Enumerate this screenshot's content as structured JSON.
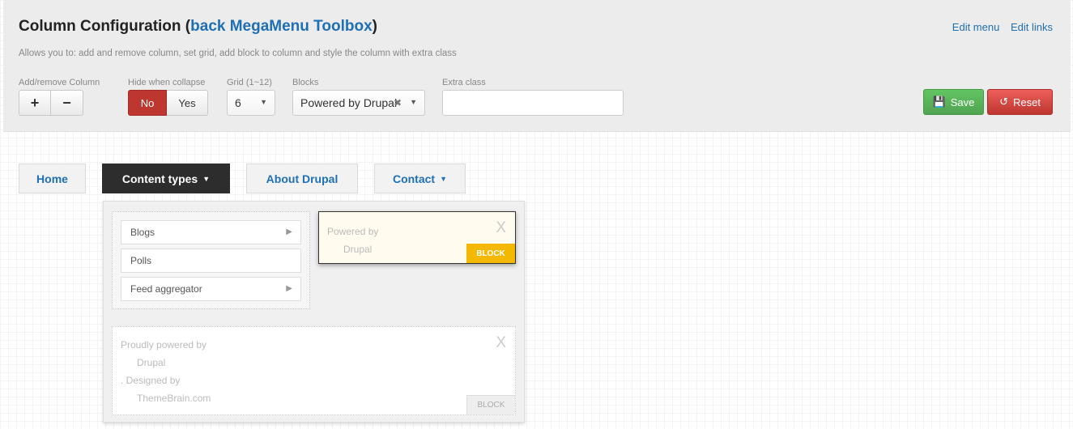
{
  "toolbox": {
    "title_prefix": "Column Configuration (",
    "title_link": "back MegaMenu Toolbox",
    "title_suffix": ")",
    "edit_menu": "Edit menu",
    "edit_links": "Edit links",
    "description": "Allows you to: add and remove column, set grid, add block to column and style the column with extra class",
    "add_remove_label": "Add/remove Column",
    "add_icon": "+",
    "remove_icon": "−",
    "hide_label": "Hide when collapse",
    "hide_no": "No",
    "hide_yes": "Yes",
    "hide_selected": "No",
    "grid_label": "Grid (1~12)",
    "grid_value": "6",
    "blocks_label": "Blocks",
    "blocks_value": "Powered by Drupal",
    "extra_label": "Extra class",
    "extra_value": "",
    "save_label": "Save",
    "reset_label": "Reset"
  },
  "nav": {
    "items": [
      {
        "label": "Home"
      },
      {
        "label": "Content types",
        "active": true
      },
      {
        "label": "About Drupal"
      },
      {
        "label": "Contact"
      }
    ]
  },
  "dropdown": {
    "list_items": [
      {
        "label": "Blogs",
        "has_sub": true
      },
      {
        "label": "Polls",
        "has_sub": false
      },
      {
        "label": "Feed aggregator",
        "has_sub": true
      }
    ],
    "block_one": {
      "line1": "Powered by",
      "line2": "Drupal",
      "badge": "BLOCK",
      "close": "X"
    },
    "block_two": {
      "line1": "Proudly powered by",
      "line2": "Drupal",
      "line3": ". Designed by",
      "line4": "ThemeBrain.com",
      "badge": "BLOCK",
      "close": "X"
    }
  },
  "colors": {
    "link": "#1f6fb5",
    "danger": "#bd362f",
    "success": "#51a351",
    "badge": "#f5b800"
  }
}
